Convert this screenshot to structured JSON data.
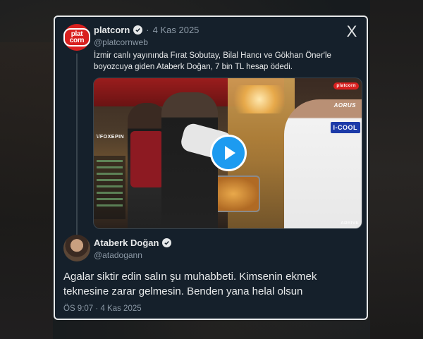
{
  "tweet": {
    "author_name": "platcorn",
    "author_handle": "@platcornweb",
    "date_separator": "·",
    "date": "4 Kas 2025",
    "text": "İzmir canlı yayınında Fırat Sobutay, Bilal Hancı ve Gökhan Öner'le boyozcuya giden Ataberk Doğan, 7 bin TL hesap ödedi.",
    "avatar_label": "plat corn",
    "media": {
      "watermarks": {
        "foxepin": "\\/FOXEPIN",
        "aorus": "AORUS",
        "icool": "I-COOL",
        "platcorn": "platcorn",
        "adrive": "ADRIVE"
      }
    }
  },
  "reply": {
    "author_name": "Ataberk Doğan",
    "author_handle": "@atadogann",
    "text": "Agalar siktir edin salın şu muhabbeti. Kimsenin ekmek teknesine zarar gelmesin. Benden yana helal olsun",
    "time": "ÖS 9:07",
    "date_separator": "·",
    "date": "4 Kas 2025"
  },
  "close_label": "X",
  "colors": {
    "card_bg": "#15202b",
    "text": "#e7e9ea",
    "muted": "#8b98a5",
    "accent": "#1d9bf0",
    "brand_red": "#d9201f"
  },
  "icons": [
    "close-icon",
    "verified-badge-icon",
    "play-icon"
  ]
}
